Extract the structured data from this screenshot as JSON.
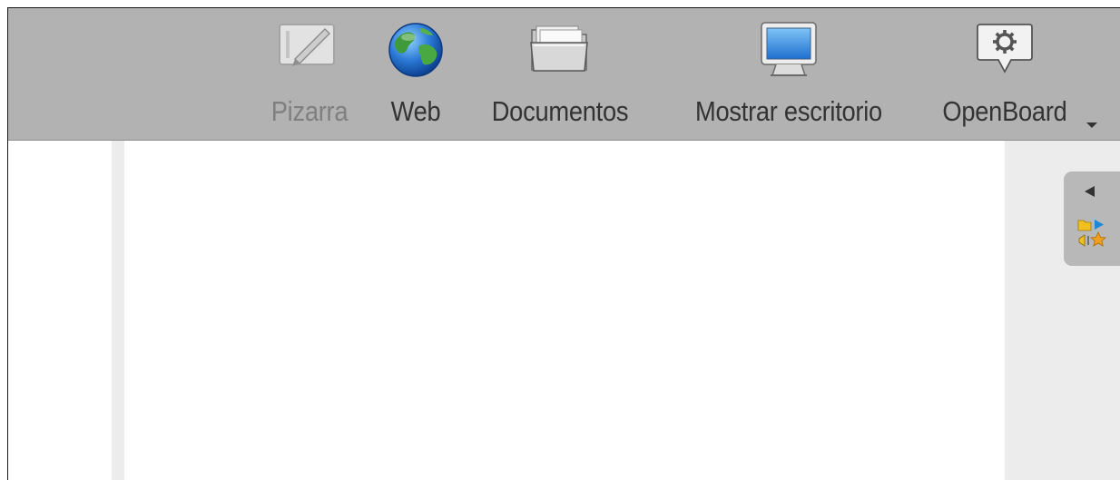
{
  "toolbar": {
    "buttons": [
      {
        "id": "pizarra",
        "label": "Pizarra",
        "icon": "whiteboard-pen-icon",
        "disabled": true
      },
      {
        "id": "web",
        "label": "Web",
        "icon": "globe-icon",
        "disabled": false
      },
      {
        "id": "documentos",
        "label": "Documentos",
        "icon": "folder-icon",
        "disabled": false
      },
      {
        "id": "mostrar-escritorio",
        "label": "Mostrar escritorio",
        "icon": "monitor-icon",
        "disabled": false
      },
      {
        "id": "openboard",
        "label": "OpenBoard",
        "icon": "gear-speech-bubble-icon",
        "disabled": false
      }
    ],
    "menu_indicator_icon": "chevron-down-icon"
  },
  "palette": {
    "collapse_icon": "triangle-left-icon",
    "library_icon": "library-mixed-icons"
  },
  "colors": {
    "toolbar_bg": "#b2b2b2",
    "side_gray": "#ececec",
    "board_bg": "#ffffff",
    "label_text": "#333333",
    "label_disabled": "#7f7f7f"
  }
}
